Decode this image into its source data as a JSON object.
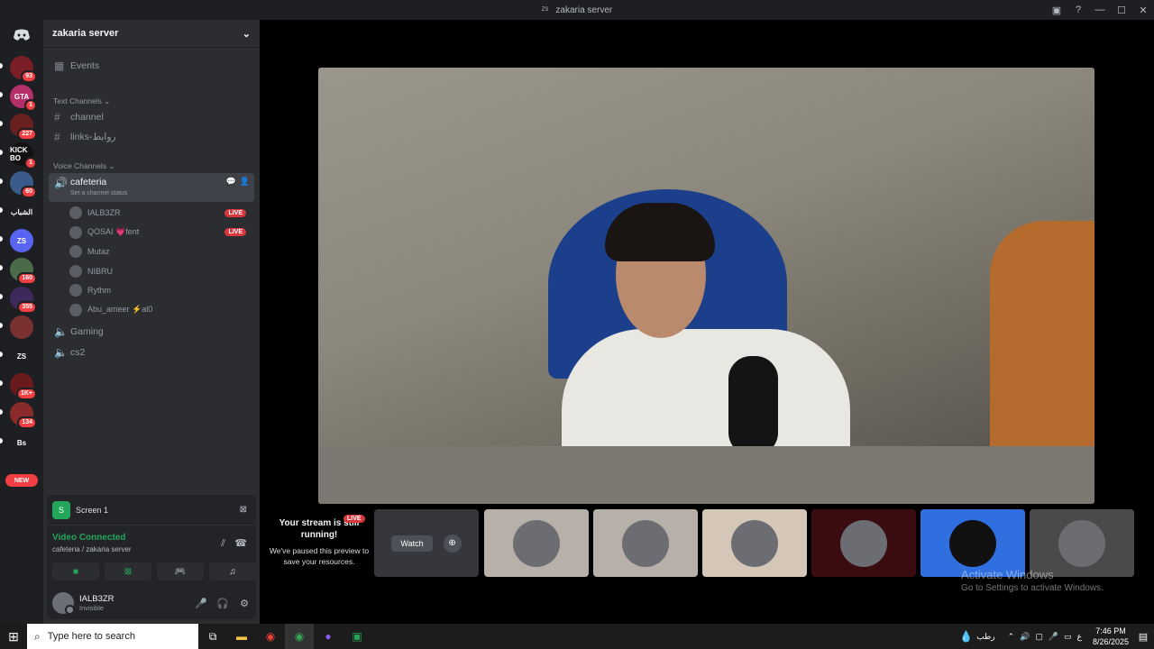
{
  "window": {
    "badge": "ZS",
    "title": "zakaria server"
  },
  "rail": {
    "servers": [
      {
        "label": "",
        "badge": "93",
        "color": "#7a1f28"
      },
      {
        "label": "GTA",
        "badge": "1",
        "color": "#b52f6a"
      },
      {
        "label": "",
        "badge": "227",
        "color": "#6b2020"
      },
      {
        "label": "KICK BO",
        "badge": "1",
        "color": "#111111"
      },
      {
        "label": "",
        "badge": "60",
        "color": "#3a5a8a"
      },
      {
        "label": "الشباب",
        "badge": "",
        "color": "#1e1f22"
      },
      {
        "label": "ZS",
        "badge": "",
        "color": "#5865f2"
      },
      {
        "label": "",
        "badge": "160",
        "color": "#4a6a4a"
      },
      {
        "label": "",
        "badge": "355",
        "color": "#3d2a5a"
      },
      {
        "label": "",
        "badge": "",
        "color": "#7a3030"
      },
      {
        "label": "ZS",
        "badge": "",
        "color": "#1e1f22"
      },
      {
        "label": "",
        "badge": "1K+",
        "color": "#6a1a1a"
      },
      {
        "label": "",
        "badge": "134",
        "color": "#8a2a2a"
      },
      {
        "label": "Bs",
        "badge": "",
        "color": "#1e1f22"
      }
    ],
    "new_label": "NEW"
  },
  "sidebar": {
    "server_name": "zakaria server",
    "events_label": "Events",
    "text_category": "Text Channels",
    "text_channels": [
      "channel",
      "links-روابط"
    ],
    "voice_category": "Voice Channels",
    "active_voice": {
      "name": "cafeteria",
      "status_placeholder": "Set a channel status"
    },
    "voice_users": [
      {
        "name": "ΙALB3ZR",
        "live": "LIVE"
      },
      {
        "name": "QOSAI 💗fent",
        "live": "LIVE"
      },
      {
        "name": "Mutaz",
        "live": ""
      },
      {
        "name": "NIBRU",
        "live": ""
      },
      {
        "name": "Rythm",
        "live": ""
      },
      {
        "name": "Abu_ameer ⚡al0",
        "live": ""
      }
    ],
    "other_voice": [
      "Gaming",
      "cs2"
    ]
  },
  "panel": {
    "screen_badge": "S",
    "screen_label": "Screen 1",
    "voice_status": "Video Connected",
    "voice_sub": "cafeteria / zakaria server",
    "user_name": "ΙALB3ZR",
    "user_status": "Invisible"
  },
  "stream": {
    "live": "LIVE",
    "title": "Your stream is still running!",
    "subtitle": "We've paused this preview to save your resources.",
    "watch_label": "Watch",
    "tiles": [
      {
        "color": "#b7b0a8"
      },
      {
        "color": "#b7b0a8"
      },
      {
        "color": "#d4c7b8"
      },
      {
        "color": "#3a0c10"
      },
      {
        "color": "#2f6fe0"
      },
      {
        "color": "#4a4a4a"
      }
    ]
  },
  "activation": {
    "line1": "Activate Windows",
    "line2": "Go to Settings to activate Windows."
  },
  "taskbar": {
    "search_placeholder": "Type here to search",
    "weather": "رطب",
    "lang": "ع",
    "time": "7:46 PM",
    "date": "8/26/2025"
  }
}
